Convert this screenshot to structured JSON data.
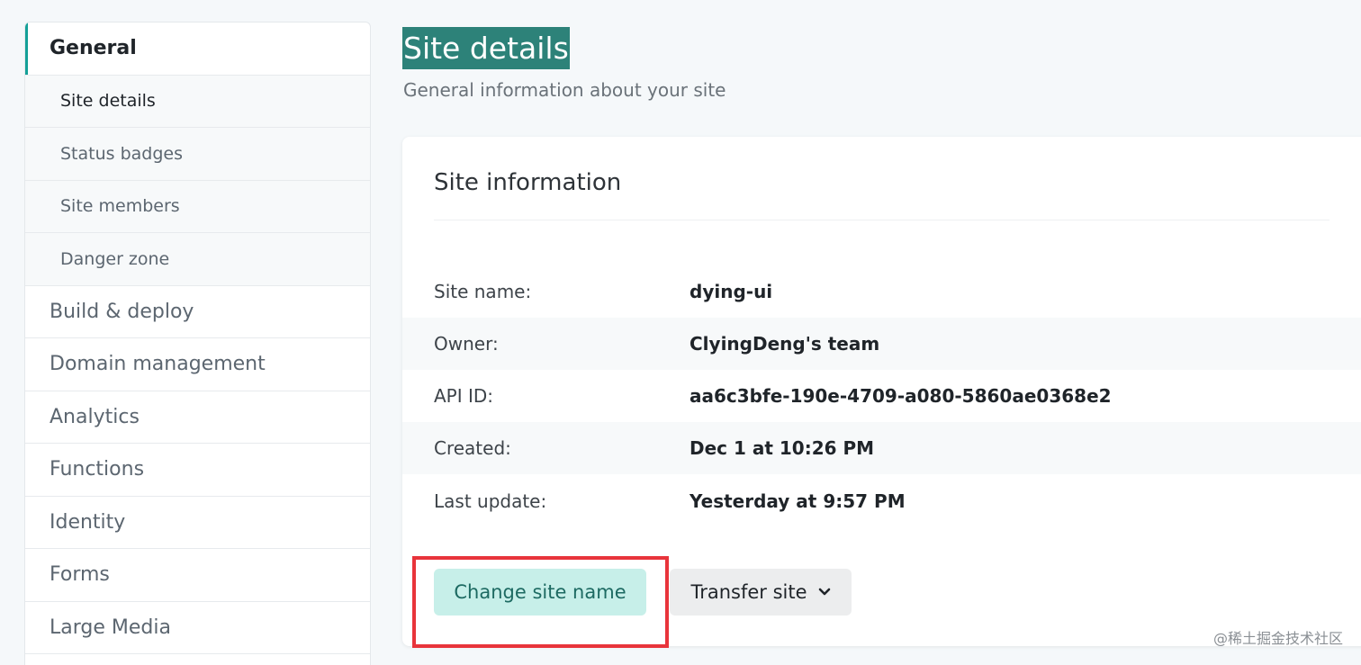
{
  "sidebar": {
    "general": "General",
    "sub_items": [
      "Site details",
      "Status badges",
      "Site members",
      "Danger zone"
    ],
    "items": [
      "Build & deploy",
      "Domain management",
      "Analytics",
      "Functions",
      "Identity",
      "Forms",
      "Large Media"
    ]
  },
  "header": {
    "title": "Site details",
    "subtitle": "General information about your site"
  },
  "card": {
    "title": "Site information",
    "rows": [
      {
        "label": "Site name:",
        "value": "dying-ui"
      },
      {
        "label": "Owner:",
        "value": "ClyingDeng's team"
      },
      {
        "label": "API ID:",
        "value": "aa6c3bfe-190e-4709-a080-5860ae0368e2"
      },
      {
        "label": "Created:",
        "value": "Dec 1 at 10:26 PM"
      },
      {
        "label": "Last update:",
        "value": "Yesterday at 9:57 PM"
      }
    ],
    "change_name_label": "Change site name",
    "transfer_label": "Transfer site"
  },
  "watermark": "@稀土掘金技术社区",
  "colors": {
    "accent": "#14a098",
    "title_bg": "#2d8279",
    "primary_button_bg": "#c7efe9",
    "highlight": "#e8343b"
  }
}
